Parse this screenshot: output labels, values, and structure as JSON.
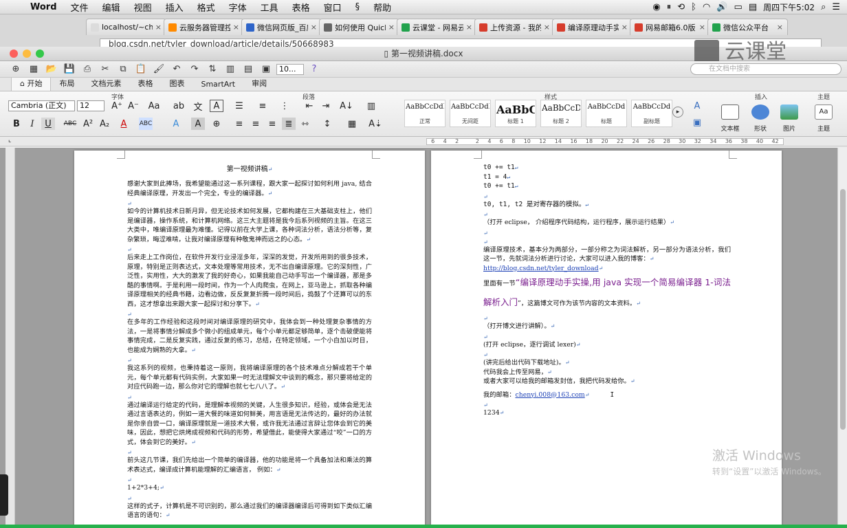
{
  "menubar": {
    "app": "Word",
    "items": [
      "文件",
      "编辑",
      "视图",
      "插入",
      "格式",
      "字体",
      "工具",
      "表格",
      "窗口",
      "帮助"
    ],
    "clock": "周四下午5:02"
  },
  "browser": {
    "tabs": [
      {
        "label": "localhost/~che",
        "color": "#dcdcdc"
      },
      {
        "label": "云服务器管理控",
        "color": "#ff8a00"
      },
      {
        "label": "微信网页版_百度",
        "color": "#2e64c9"
      },
      {
        "label": "如何使用 Quick",
        "color": "#666666"
      },
      {
        "label": "云课堂 - 网易云",
        "color": "#21a24c"
      },
      {
        "label": "上传资源 - 我的",
        "color": "#d63c2c"
      },
      {
        "label": "编译原理动手实",
        "color": "#d63c2c"
      },
      {
        "label": "网易邮箱6.0版",
        "color": "#d63c2c"
      },
      {
        "label": "微信公众平台",
        "color": "#21a24c"
      }
    ],
    "url": "blog.csdn.net/tyler_download/article/details/50668983"
  },
  "word": {
    "doc_title": "第一视频讲稿.docx",
    "watermark": "云课堂",
    "zoom": "10...",
    "search_placeholder": "在文档中搜索",
    "ribbon_tabs": [
      "开始",
      "布局",
      "文档元素",
      "表格",
      "图表",
      "SmartArt",
      "审阅"
    ],
    "groups": {
      "font": "字体",
      "paragraph": "段落",
      "styles": "样式",
      "insert": "插入",
      "theme": "主题"
    },
    "font_name": "Cambria (正文)",
    "font_size": "12",
    "styles": [
      {
        "sample": "AaBbCcDdEe",
        "name": "正常"
      },
      {
        "sample": "AaBbCcDdEe",
        "name": "无间距"
      },
      {
        "sample": "AaBbC",
        "name": "标题 1"
      },
      {
        "sample": "AaBbCcDd",
        "name": "标题 2"
      },
      {
        "sample": "AaBbCcDd",
        "name": "标题"
      },
      {
        "sample": "AaBbCcDd",
        "name": "副标题"
      }
    ],
    "insert_buttons": [
      "文本框",
      "形状",
      "图片"
    ],
    "theme_button": "主题",
    "ruler_numbers": [
      "6",
      "4",
      "2",
      "",
      "2",
      "4",
      "6",
      "8",
      "10",
      "12",
      "14",
      "16",
      "18",
      "20",
      "22",
      "24",
      "26",
      "28",
      "30",
      "32",
      "34",
      "36",
      "38",
      "40",
      "42"
    ]
  },
  "page_left": {
    "title": "第一视频讲稿",
    "paragraphs": [
      "感谢大家到此捧场，我希望能通过这一系列课程，跟大家一起探讨如何利用 java, 结合经典编译原理，开发出一个完全，专业的编译器。",
      "如今的计算机技术日新月异，但无论技术如何发展，它都构建在三大基础支柱上，他们是编译器，操作系统，和计算机网络。这三大主题将是我今后系列视频的主旨。在这三大类中，唯编译原理最为难懂。记得以前在大学上课，各种词法分析，语法分析等，复杂繁琐，晦涩难啃，让我对编译原理有种敬鬼神而远之的心态。",
      "后来走上工作岗位，在软件开发行业浸淫多年，深深的发觉，开发所用到的很多技术，原理，特别是正则表达式，文本处理等常用技术，无不出自编译原理。它的深刻性，广泛性，实用性，大大的激发了我的好奇心，如果我能自己动手写出一个编译器，那是多酷的事情啊。于是利用一段时间，作为一个人肉爬虫，在网上，亚马逊上，抓取各种编译原理相关的经典书籍，边看边做，反反复复折腾一段时间后，捣鼓了个还算可以的东西，这才想拿出来跟大家一起探讨和分享下。",
      "在多年的工作经验和这段时间对编译原理的研究中，我体会到一种处理复杂事情的方法，一是将事情分解成多个微小的组成单元，每个小单元都足够简单，逐个击破便能将事情完成，二是反复实践，通过反复的练习，总结，在特定领域，一个小白加以时日，也能成为娴熟的大拿。",
      "我这系列的视频，也秉持着这一原则，我将编译原理的各个技术难点分解成若干个单元，每个单元都有代码实例，大家如果一时无法理解文中谈到的概念，那只要将给定的对应代码跑一边，那么你对它的理解也就七七八八了。",
      "通过编译运行给定的代码，是理解本视频的关键，人生很多知识，经验，或体会是无法通过言语表达的，例如一道大餐的味道如何鲜美，用言语是无法传达的，最好的办法就是你亲自尝一口，编译原理就是一道技术大餐，或许我无法通过言辞让您体会到它的美味，因此，想把它烘烤成视频和代码的形势，希望借此，能使得大家通过“咬”一口的方式，体会到它的美好。",
      "前头这几节课，我们先给出一个简单的编译器，他的功能是将一个具备加法和乘法的算术表达式，编译成计算机能理解的汇编语言，   例如：",
      "1+2*3+4;",
      "这样的式子，计算机是不可识别的，那么通过我们的编译器编译后可得到如下类似汇编语言的语句："
    ]
  },
  "page_right": {
    "code": [
      "t0 += t1",
      "t1 = 4",
      "t0 += t1"
    ],
    "regs": "t0, t1, t2 是对寄存器的模拟。",
    "note1": "（打开 eclipse， 介绍程序代码结构，运行程序，展示运行结果）",
    "intro": "编译原理技术，基本分为两部分，一部分称之为词法解析，另一部分为语法分析，我们这一节，先就词法分析进行讨论，大家可以进入我的博客：",
    "blog": "http://blog.csdn.net/tyler_download",
    "ref_prefix": "里面有一节",
    "ref_title": "“编译原理动手实操,用 java 实现一个简易编译器 1-词法解析入门",
    "ref_suffix": "”，这篇博文可作为该节内容的文本资料。",
    "note2": "（打开博文进行讲解）。",
    "note3": "(打开 eclipse，逐行调试 lexer)",
    "note4": "(讲完后给出代码下载地址)。",
    "note5": "代码我会上传至网易，",
    "note6": "或者大家可以给我的邮箱发封信，我把代码发给你。",
    "email_label": "我的邮箱：",
    "email": "chenyi.008@163.com",
    "last": "1234"
  },
  "windows_watermark": {
    "line1": "激活 Windows",
    "line2": "转到“设置”以激活 Windows。"
  }
}
